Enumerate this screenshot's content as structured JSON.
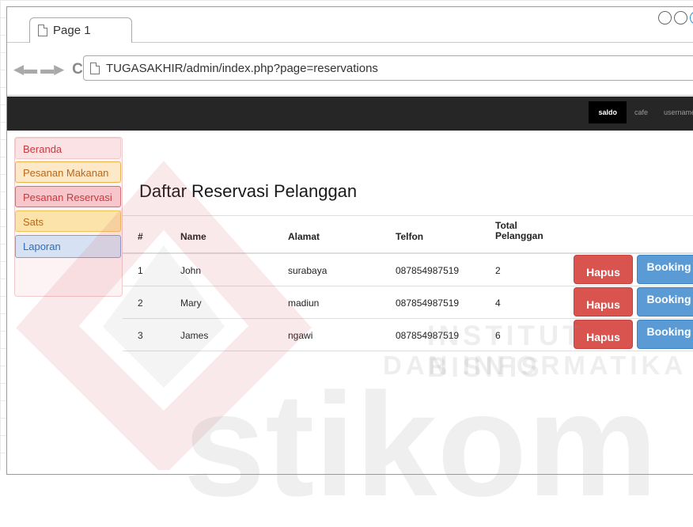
{
  "browser": {
    "tab_title": "Page 1",
    "url": "TUGASAKHIR/admin/index.php?page=reservations"
  },
  "appbar": {
    "items": [
      "saldo",
      "cafe",
      "username"
    ]
  },
  "sidebar": {
    "items": [
      {
        "label": "Beranda"
      },
      {
        "label": "Pesanan Makanan"
      },
      {
        "label": "Pesanan Reservasi"
      },
      {
        "label": "Sats"
      },
      {
        "label": "Laporan"
      }
    ]
  },
  "main": {
    "title": "Daftar Reservasi Pelanggan",
    "table": {
      "headers": [
        "#",
        "Name",
        "Alamat",
        "Telfon",
        "Total Pelanggan"
      ],
      "rows": [
        {
          "no": "1",
          "name": "John",
          "alamat": "surabaya",
          "telfon": "087854987519",
          "total": "2"
        },
        {
          "no": "2",
          "name": "Mary",
          "alamat": "madiun",
          "telfon": "087854987519",
          "total": "4"
        },
        {
          "no": "3",
          "name": "James",
          "alamat": "ngawi",
          "telfon": "087854987519",
          "total": "6"
        }
      ],
      "delete_label": "Hapus",
      "booking_label": "Booking"
    }
  },
  "watermark": {
    "line1": "INSTITUT BISNIS",
    "line2": "DAN INFORMATIKA",
    "brand": "stikom"
  }
}
